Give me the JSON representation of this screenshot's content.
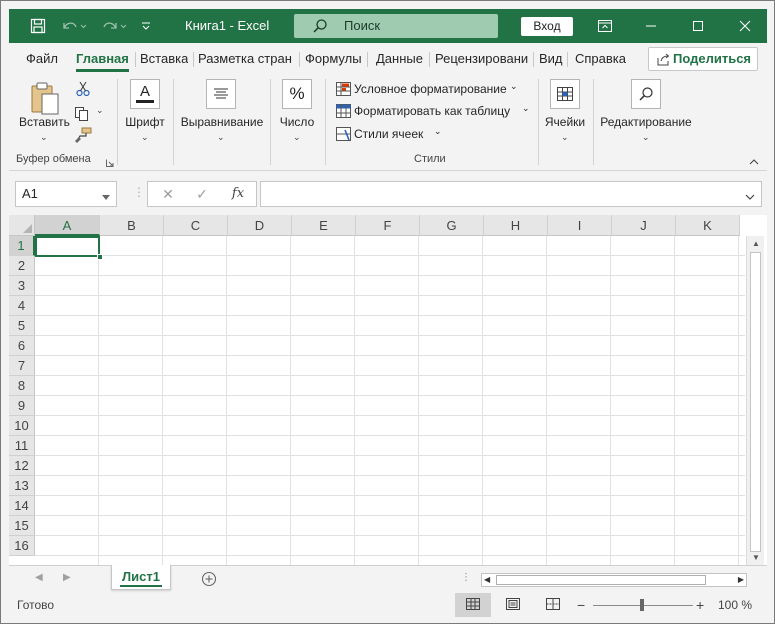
{
  "titlebar": {
    "title": "Книга1  -  Excel",
    "search_label": "Поиск",
    "signin_label": "Вход",
    "icons": [
      "save-icon",
      "undo-icon",
      "redo-icon",
      "customize-qat-icon",
      "ribbon-display-icon",
      "minimize-icon",
      "maximize-icon",
      "close-icon"
    ]
  },
  "tabs": {
    "items": [
      {
        "label": "Файл"
      },
      {
        "label": "Главная"
      },
      {
        "label": "Вставка"
      },
      {
        "label": "Разметка страни"
      },
      {
        "label": "Формулы"
      },
      {
        "label": "Данные"
      },
      {
        "label": "Рецензировани"
      },
      {
        "label": "Вид"
      },
      {
        "label": "Справка"
      }
    ],
    "active": "Главная",
    "share_label": "Поделиться"
  },
  "ribbon": {
    "paste_label": "Вставить",
    "clipboard_group": "Буфер обмена",
    "font_label": "Шрифт",
    "alignment_label": "Выравнивание",
    "number_label": "Число",
    "styles": {
      "conditional": "Условное форматирование",
      "as_table": "Форматировать как таблицу",
      "cell_styles": "Стили ячеек",
      "group": "Стили"
    },
    "cells_label": "Ячейки",
    "editing_label": "Редактирование",
    "number_symbol": "%",
    "font_symbol": "A"
  },
  "formula_bar": {
    "name_box": "A1",
    "cancel": "✕",
    "enter": "✓",
    "fx": "fx",
    "value": ""
  },
  "grid": {
    "columns": [
      "A",
      "B",
      "C",
      "D",
      "E",
      "F",
      "G",
      "H",
      "I",
      "J",
      "K"
    ],
    "rows": [
      "1",
      "2",
      "3",
      "4",
      "5",
      "6",
      "7",
      "8",
      "9",
      "10",
      "11",
      "12",
      "13",
      "14",
      "15",
      "16"
    ],
    "selected_cell": "A1"
  },
  "sheets": {
    "items": [
      "Лист1"
    ],
    "active": "Лист1"
  },
  "statusbar": {
    "status": "Готово",
    "zoom_minus": "−",
    "zoom_plus": "+",
    "zoom": "100 %"
  },
  "colors": {
    "accent": "#217346",
    "search_bg": "#9fcbb0"
  }
}
